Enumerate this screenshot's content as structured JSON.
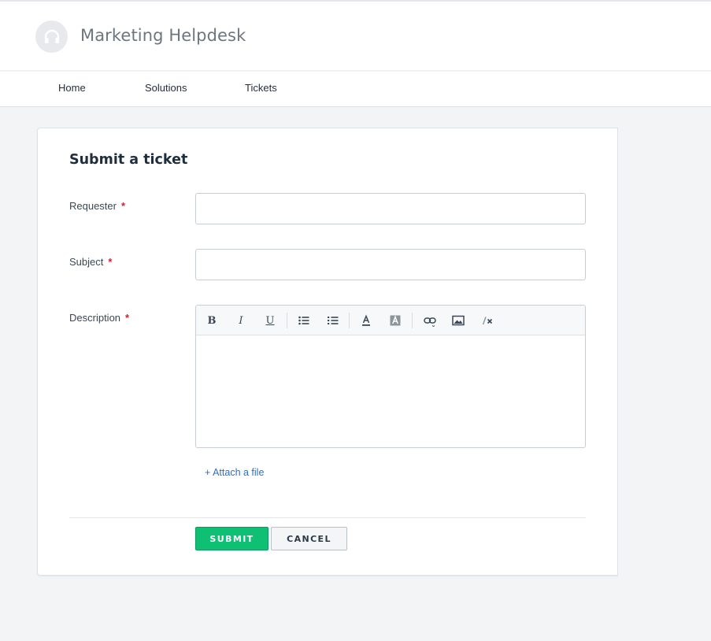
{
  "header": {
    "brand": "Marketing Helpdesk",
    "logo_icon": "headset-icon"
  },
  "nav": {
    "items": [
      {
        "label": "Home"
      },
      {
        "label": "Solutions"
      },
      {
        "label": "Tickets"
      }
    ]
  },
  "form": {
    "title": "Submit a ticket",
    "requester_label": "Requester",
    "subject_label": "Subject",
    "description_label": "Description",
    "required_mark": "*",
    "requester_value": "",
    "subject_value": "",
    "description_value": "",
    "attach_label": "+ Attach a file",
    "submit_label": "SUBMIT",
    "cancel_label": "CANCEL"
  },
  "toolbar": {
    "bold": "B",
    "italic": "I",
    "underline": "U",
    "icons": [
      "bold-icon",
      "italic-icon",
      "underline-icon",
      "bulleted-list-icon",
      "numbered-list-icon",
      "font-color-icon",
      "background-color-icon",
      "link-icon",
      "image-icon",
      "clear-format-icon"
    ]
  },
  "colors": {
    "accent": "#0fbf73",
    "link": "#2c6fc4",
    "required": "#d4202e"
  }
}
